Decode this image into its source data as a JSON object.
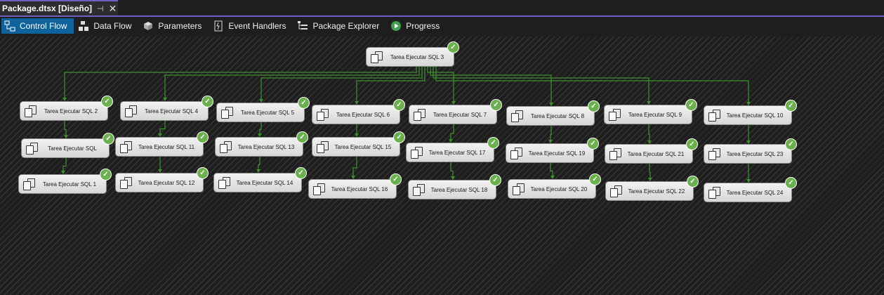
{
  "document_tab": {
    "title": "Package.dtsx [Diseño]",
    "pin_icon": "pin-icon",
    "close_icon": "close-icon"
  },
  "designer_tabs": [
    {
      "label": "Control Flow",
      "icon": "control-flow-icon",
      "active": true
    },
    {
      "label": "Data Flow",
      "icon": "data-flow-icon",
      "active": false
    },
    {
      "label": "Parameters",
      "icon": "parameters-icon",
      "active": false
    },
    {
      "label": "Event Handlers",
      "icon": "event-handlers-icon",
      "active": false
    },
    {
      "label": "Package Explorer",
      "icon": "package-explorer-icon",
      "active": false
    },
    {
      "label": "Progress",
      "icon": "progress-icon",
      "active": false
    }
  ],
  "colors": {
    "accent": "#6c5fc7",
    "active_tab": "#0e639c",
    "connector": "#3e8e2e",
    "success": "#6ab04c",
    "canvas_background": "#1e1e1e"
  },
  "root_task": {
    "label": "Tarea Ejecutar SQL 3",
    "status": "success"
  },
  "columns": [
    [
      "Tarea Ejecutar SQL 2",
      "Tarea Ejecutar SQL",
      "Tarea Ejecutar SQL 1"
    ],
    [
      "Tarea Ejecutar SQL 4",
      "Tarea Ejecutar SQL 11",
      "Tarea Ejecutar SQL 12"
    ],
    [
      "Tarea Ejecutar SQL 5",
      "Tarea Ejecutar SQL 13",
      "Tarea Ejecutar SQL 14"
    ],
    [
      "Tarea Ejecutar SQL 6",
      "Tarea Ejecutar SQL 15",
      "Tarea Ejecutar SQL 16"
    ],
    [
      "Tarea Ejecutar SQL 7",
      "Tarea Ejecutar SQL 17",
      "Tarea Ejecutar SQL 18"
    ],
    [
      "Tarea Ejecutar SQL 8",
      "Tarea Ejecutar SQL 19",
      "Tarea Ejecutar SQL 20"
    ],
    [
      "Tarea Ejecutar SQL 9",
      "Tarea Ejecutar SQL 21",
      "Tarea Ejecutar SQL 22"
    ],
    [
      "Tarea Ejecutar SQL 10",
      "Tarea Ejecutar SQL 23",
      "Tarea Ejecutar SQL 24"
    ]
  ],
  "task_icon": "execute-sql-task-icon",
  "status_icon": "success-check-icon"
}
